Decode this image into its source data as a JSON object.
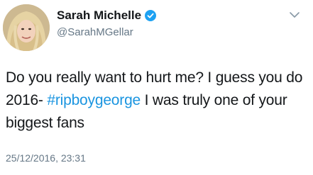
{
  "profile": {
    "display_name": "Sarah Michelle",
    "handle": "@SarahMGellar",
    "verified": true,
    "avatar_icon": "profile-photo"
  },
  "menu": {
    "icon": "chevron-down-icon"
  },
  "tweet": {
    "text_before": "Do you really want to hurt me? I guess you do 2016- ",
    "hashtag": "#ripboygeorge",
    "text_after": " I was truly one of your biggest fans",
    "timestamp": "25/12/2016, 23:31"
  },
  "colors": {
    "hashtag": "#1b95e0",
    "verified_badge": "#1da1f2",
    "secondary_text": "#657786",
    "primary_text": "#14171a"
  }
}
